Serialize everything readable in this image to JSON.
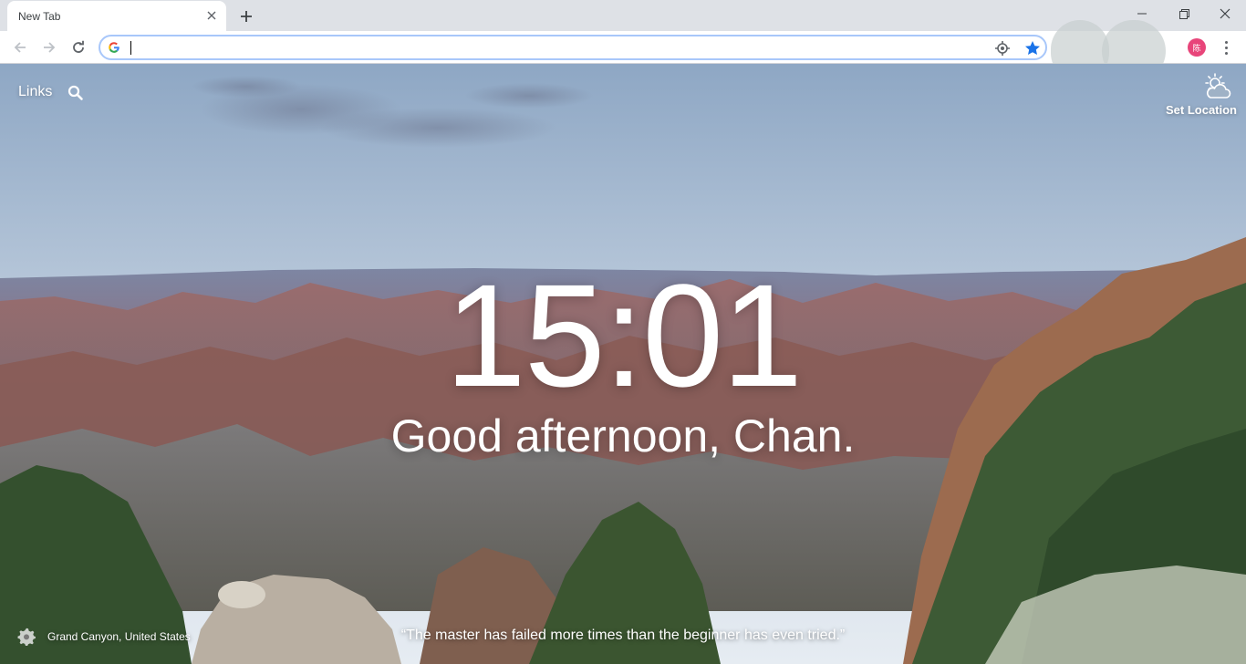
{
  "browser": {
    "tab": {
      "title": "New Tab"
    },
    "omnibox": {
      "value": "",
      "placeholder": ""
    },
    "profile": {
      "initial": "陈",
      "color": "#e8457a"
    },
    "accent_color": "#1a73e8"
  },
  "page": {
    "links_label": "Links",
    "weather": {
      "label": "Set Location",
      "icon": "partly-cloudy-icon"
    },
    "clock": {
      "time": "15:01"
    },
    "greeting": "Good afternoon, Chan.",
    "photo_location": "Grand Canyon, United States",
    "quote": "“The master has failed more times than the beginner has even tried.”"
  }
}
